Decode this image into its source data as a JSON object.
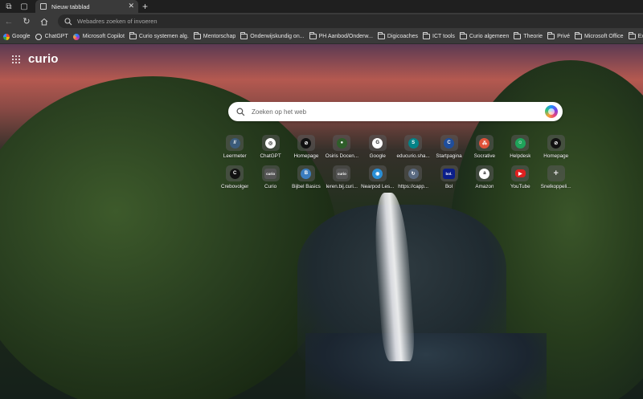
{
  "tab": {
    "title": "Nieuw tabblad"
  },
  "address_bar": {
    "placeholder": "Webadres zoeken of invoeren"
  },
  "bookmarks": [
    {
      "label": "Google",
      "icon": "google-icon"
    },
    {
      "label": "ChatGPT",
      "icon": "chatgpt-icon"
    },
    {
      "label": "Microsoft Copilot",
      "icon": "copilot-icon"
    },
    {
      "label": "Curio systemen alg.",
      "icon": "folder-icon"
    },
    {
      "label": "Mentorschap",
      "icon": "folder-icon"
    },
    {
      "label": "Onderwijskundig on...",
      "icon": "folder-icon"
    },
    {
      "label": "PH Aanbod/Onderw...",
      "icon": "folder-icon"
    },
    {
      "label": "Digicoaches",
      "icon": "folder-icon"
    },
    {
      "label": "ICT tools",
      "icon": "folder-icon"
    },
    {
      "label": "Curio algemeen",
      "icon": "folder-icon"
    },
    {
      "label": "Theorie",
      "icon": "folder-icon"
    },
    {
      "label": "Privé",
      "icon": "folder-icon"
    },
    {
      "label": "Microsoft Office",
      "icon": "folder-icon"
    },
    {
      "label": "Examenbureau",
      "icon": "folder-icon"
    }
  ],
  "brand": {
    "logo": "curio"
  },
  "search": {
    "placeholder": "Zoeken op het web"
  },
  "quick_links": [
    {
      "label": "Leermeter",
      "icon": "leermeter-icon",
      "glyph": "//",
      "color": "#3b5b7a"
    },
    {
      "label": "ChatGPT",
      "icon": "chatgpt-icon",
      "glyph": "◎",
      "color": "#ffffff"
    },
    {
      "label": "Homepage",
      "icon": "homepage-icon",
      "glyph": "⊘",
      "color": "#111111"
    },
    {
      "label": "Osiris Docen...",
      "icon": "osiris-icon",
      "glyph": "●",
      "color": "#2f5e2a"
    },
    {
      "label": "Google",
      "icon": "google-icon",
      "glyph": "G",
      "color": "#ffffff"
    },
    {
      "label": "educurio.sha...",
      "icon": "sharepoint-icon",
      "glyph": "S",
      "color": "#038387"
    },
    {
      "label": "Startpagina",
      "icon": "startpagina-icon",
      "glyph": "C",
      "color": "#1f4e9c"
    },
    {
      "label": "Socrative",
      "icon": "socrative-icon",
      "glyph": "⁂",
      "color": "#e0533a"
    },
    {
      "label": "Helpdesk",
      "icon": "helpdesk-icon",
      "glyph": "☺",
      "color": "#1fa35a"
    },
    {
      "label": "Homepage",
      "icon": "homepage-icon",
      "glyph": "⊘",
      "color": "#111111"
    },
    {
      "label": "Crebovolger",
      "icon": "crebovolger-icon",
      "glyph": "C",
      "color": "#111111"
    },
    {
      "label": "Curio",
      "icon": "curio-icon",
      "glyph": "curio",
      "color": "#555555"
    },
    {
      "label": "Bijbel Basics",
      "icon": "bijbel-icon",
      "glyph": "B",
      "color": "#3c7dbf"
    },
    {
      "label": "leren.bij.curi...",
      "icon": "curio-icon",
      "glyph": "curio",
      "color": "#555555"
    },
    {
      "label": "Nearpod Les...",
      "icon": "nearpod-icon",
      "glyph": "◉",
      "color": "#2a8fd6"
    },
    {
      "label": "https://capp...",
      "icon": "capp-icon",
      "glyph": "↻",
      "color": "#5a6a80"
    },
    {
      "label": "Bol",
      "icon": "bol-icon",
      "glyph": "bol.",
      "color": "#0b1e8a"
    },
    {
      "label": "Amazon",
      "icon": "amazon-icon",
      "glyph": "a",
      "color": "#ffffff"
    },
    {
      "label": "YouTube",
      "icon": "youtube-icon",
      "glyph": "▶",
      "color": "#e02020"
    },
    {
      "label": "Snelkoppeli...",
      "icon": "add-shortcut-icon",
      "glyph": "+",
      "color": "#6a6a6a"
    }
  ]
}
